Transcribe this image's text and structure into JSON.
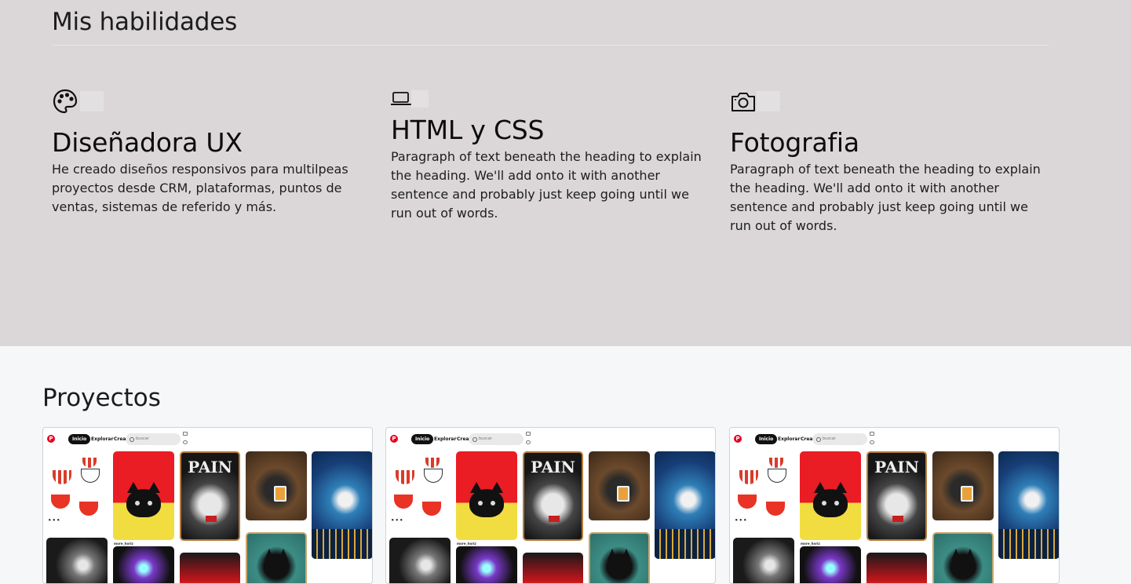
{
  "skills": {
    "title": "Mis habilidades",
    "items": [
      {
        "icon": "palette-icon",
        "heading": "Diseñadora UX",
        "text": "He creado diseños responsivos para multilpeas proyectos desde CRM, plataformas, puntos de ventas, sistemas de referido y más."
      },
      {
        "icon": "laptop-icon",
        "heading": "HTML y CSS",
        "text": "Paragraph of text beneath the heading to explain the heading. We'll add onto it with another sentence and probably just keep going until we run out of words."
      },
      {
        "icon": "camera-icon",
        "heading": "Fotografia",
        "text": "Paragraph of text beneath the heading to explain the heading. We'll add onto it with another sentence and probably just keep going until we run out of words."
      }
    ]
  },
  "projects": {
    "title": "Proyectos",
    "card_preview": {
      "logo": "P",
      "nav_active": "Inicio",
      "nav_explore": "Explorar",
      "nav_create": "Crea",
      "search_placeholder": "buscar",
      "pin_more_label": "more_horiz",
      "pin_more_dots": "•••",
      "pin_title_painting": "PAIN"
    },
    "cards": [
      {
        "name": "project-card-1"
      },
      {
        "name": "project-card-2"
      },
      {
        "name": "project-card-3"
      }
    ]
  },
  "colors": {
    "skills_bg": "#dbd7d9",
    "projects_bg": "#f6f7f9",
    "pinterest_red": "#e60023"
  }
}
